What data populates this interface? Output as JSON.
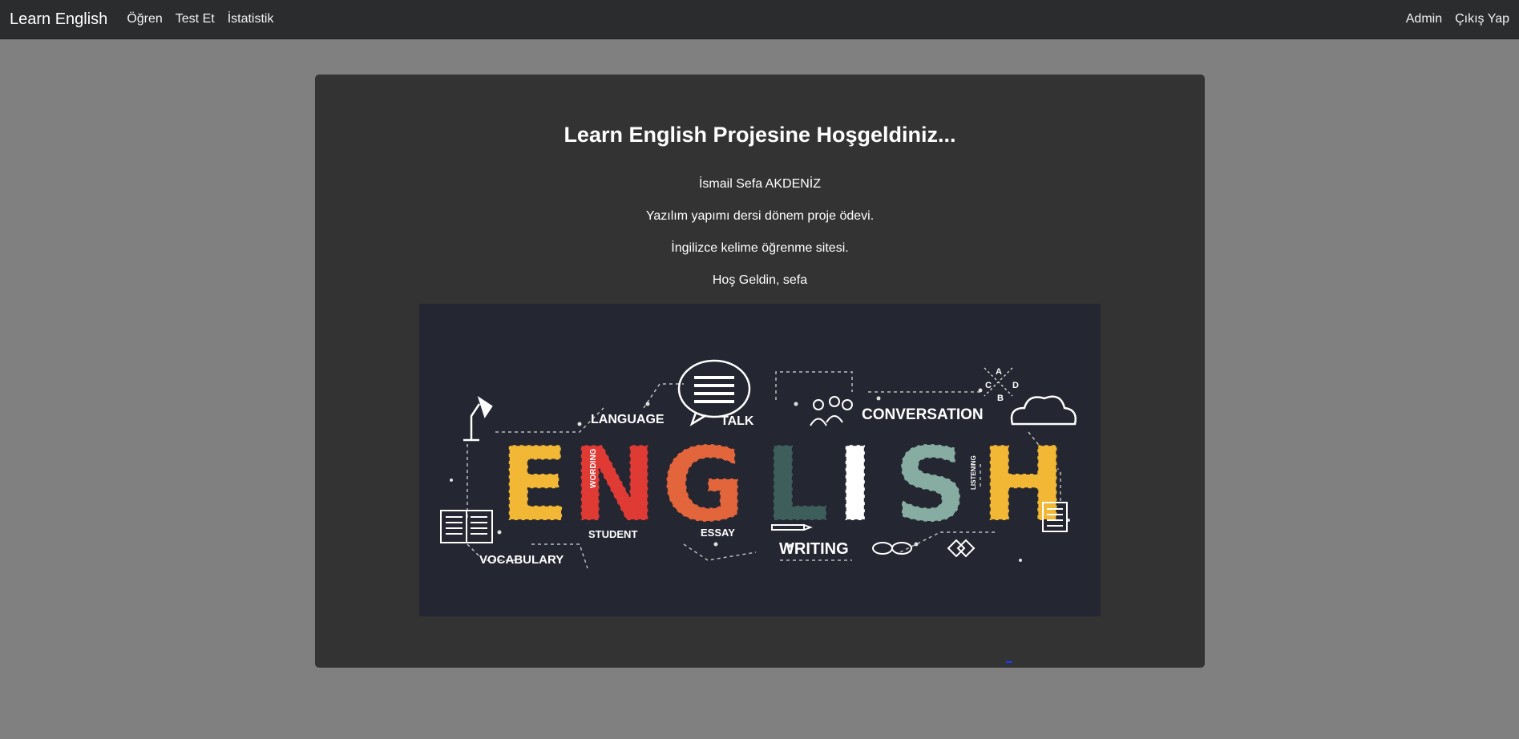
{
  "navbar": {
    "brand": "Learn English",
    "links": [
      "Öğren",
      "Test Et",
      "İstatistik"
    ],
    "right_links": [
      "Admin",
      "Çıkış Yap"
    ]
  },
  "content": {
    "title": "Learn English Projesine Hoşgeldiniz...",
    "author": "İsmail Sefa AKDENİZ",
    "description": "Yazılım yapımı dersi dönem proje ödevi.",
    "subtitle": "İngilizce kelime öğrenme sitesi.",
    "welcome": "Hoş Geldin, sefa"
  },
  "hero_image": {
    "word": "ENGLISH",
    "letters": [
      "E",
      "N",
      "G",
      "L",
      "I",
      "S",
      "H"
    ],
    "letter_colors": [
      "#f2b735",
      "#e03a35",
      "#e2653c",
      "#3e5e5c",
      "#ffffff",
      "#87ada3",
      "#f2b735"
    ],
    "labels": {
      "language": "LANGUAGE",
      "talk": "TALK",
      "conversation": "CONVERSATION",
      "wording": "WORDING",
      "listening": "LISTENING",
      "student": "STUDENT",
      "essay": "ESSAY",
      "writing": "WRITING",
      "vocabulary": "VOCABULARY",
      "a": "A",
      "b": "B",
      "c": "C",
      "d": "D"
    }
  },
  "colors": {
    "page_bg": "#808080",
    "navbar_bg": "#2b2c2e",
    "card_bg": "#333333",
    "hero_bg": "#242631"
  }
}
